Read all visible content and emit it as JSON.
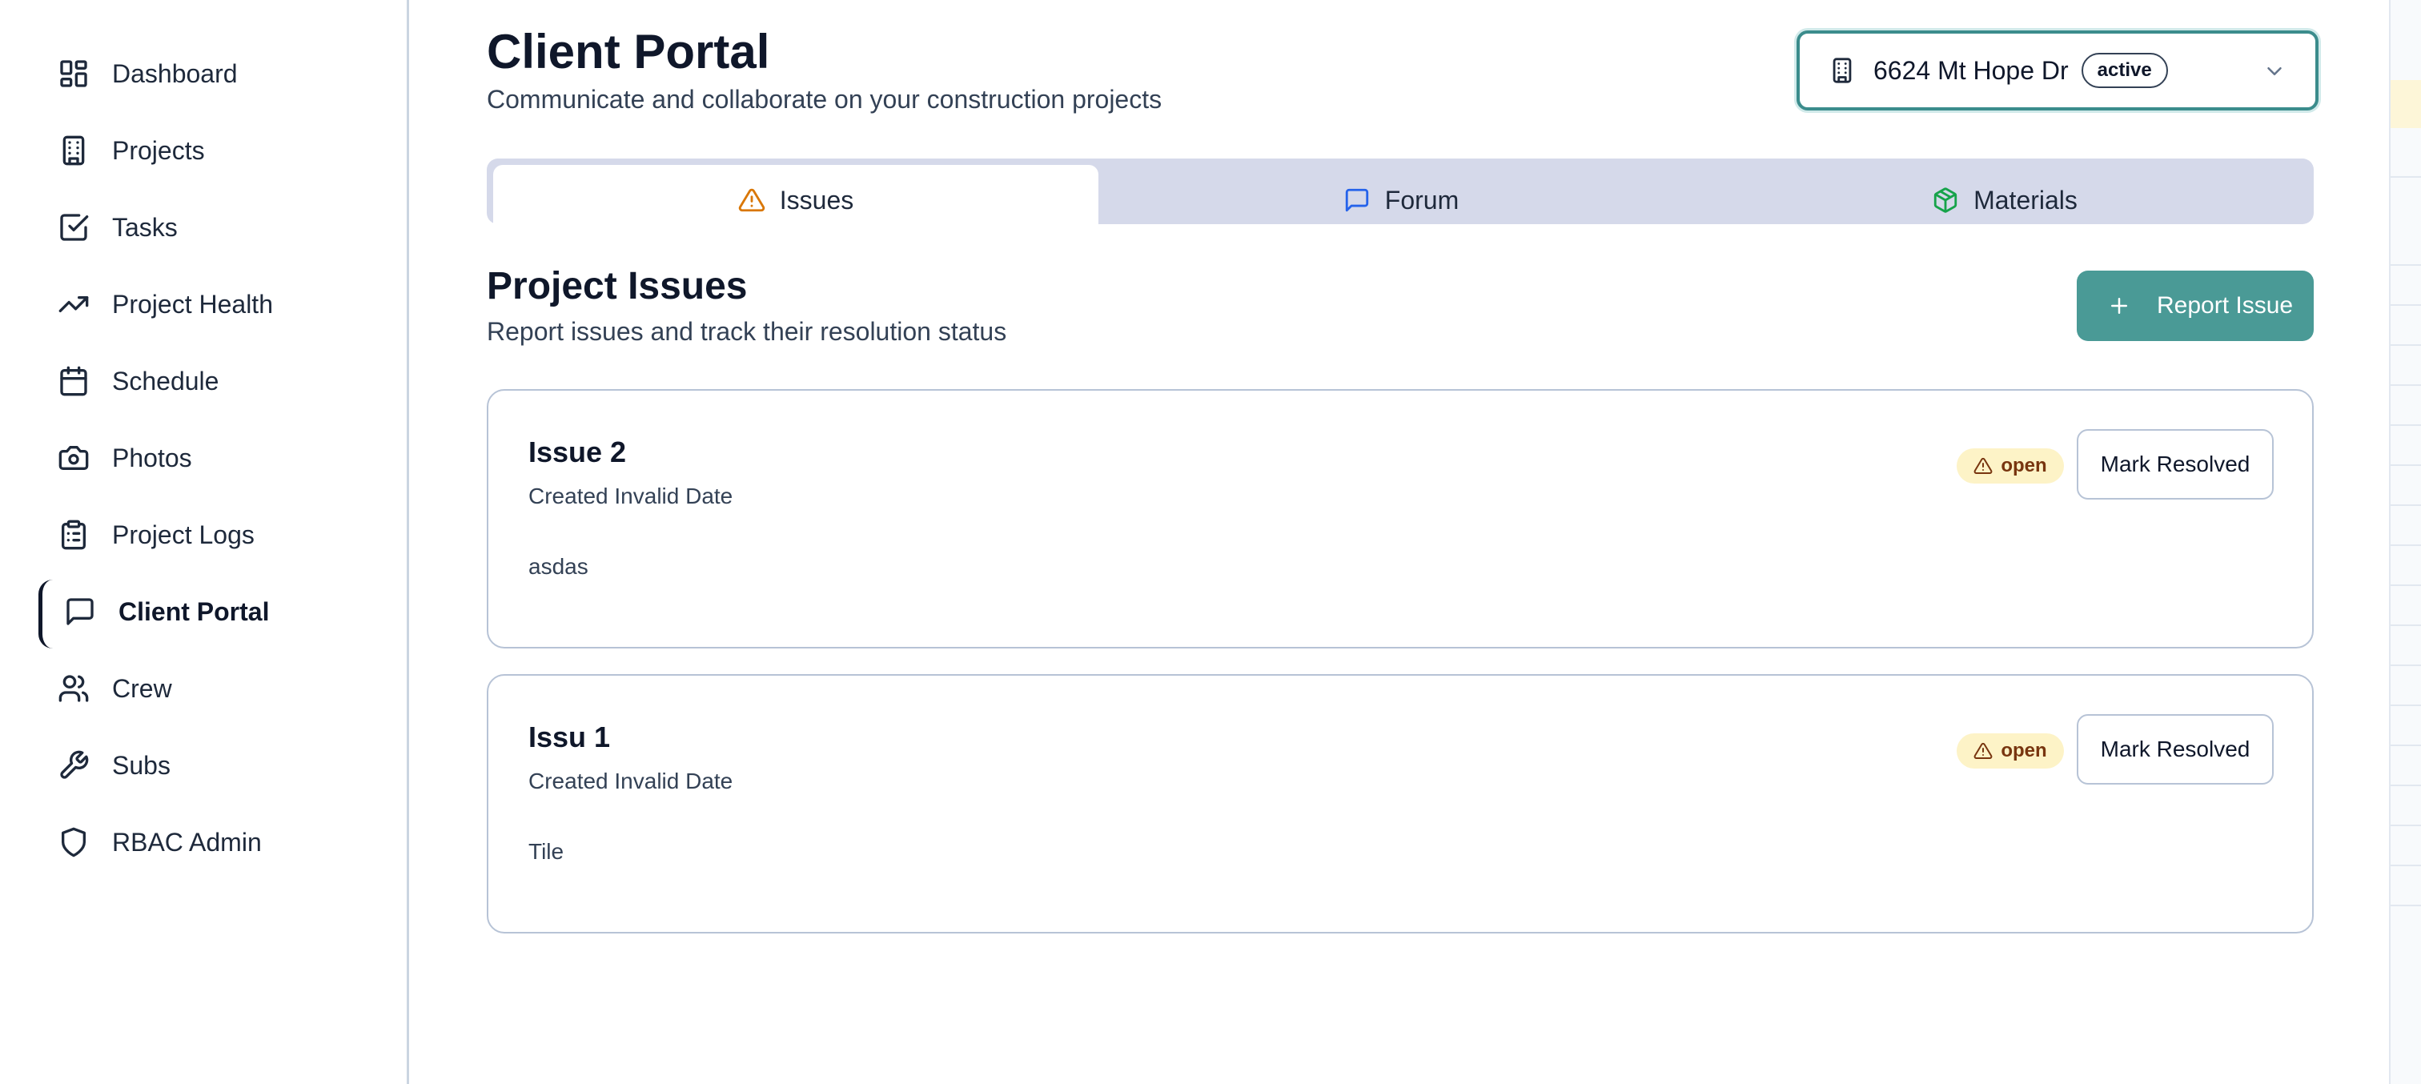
{
  "sidebar": {
    "items": [
      {
        "label": "Dashboard",
        "icon": "dashboard-icon"
      },
      {
        "label": "Projects",
        "icon": "building-icon"
      },
      {
        "label": "Tasks",
        "icon": "checkbox-icon"
      },
      {
        "label": "Project Health",
        "icon": "trending-up-icon"
      },
      {
        "label": "Schedule",
        "icon": "calendar-icon"
      },
      {
        "label": "Photos",
        "icon": "camera-icon"
      },
      {
        "label": "Project Logs",
        "icon": "clipboard-icon"
      },
      {
        "label": "Client Portal",
        "icon": "message-square-icon",
        "active": true
      },
      {
        "label": "Crew",
        "icon": "users-icon"
      },
      {
        "label": "Subs",
        "icon": "wrench-icon"
      },
      {
        "label": "RBAC Admin",
        "icon": "shield-icon"
      }
    ]
  },
  "header": {
    "title": "Client Portal",
    "subtitle": "Communicate and collaborate on your construction projects"
  },
  "project_select": {
    "name": "6624 Mt Hope Dr",
    "status": "active"
  },
  "tabs": [
    {
      "label": "Issues",
      "icon": "alert-triangle-icon",
      "icon_color": "#d97706",
      "active": true
    },
    {
      "label": "Forum",
      "icon": "message-square-icon",
      "icon_color": "#2563eb"
    },
    {
      "label": "Materials",
      "icon": "package-icon",
      "icon_color": "#16a34a"
    }
  ],
  "section": {
    "title": "Project Issues",
    "subtitle": "Report issues and track their resolution status",
    "report_button": "Report Issue"
  },
  "issues": [
    {
      "title": "Issue 2",
      "created": "Created Invalid Date",
      "description": "asdas",
      "status": "open",
      "action": "Mark Resolved"
    },
    {
      "title": "Issu 1",
      "created": "Created Invalid Date",
      "description": "Tile",
      "status": "open",
      "action": "Mark Resolved"
    }
  ],
  "colors": {
    "accent": "#4a9a96",
    "tabs_bg": "#d5d9ea",
    "status_bg": "#fdf3c7",
    "status_text": "#78350f"
  }
}
